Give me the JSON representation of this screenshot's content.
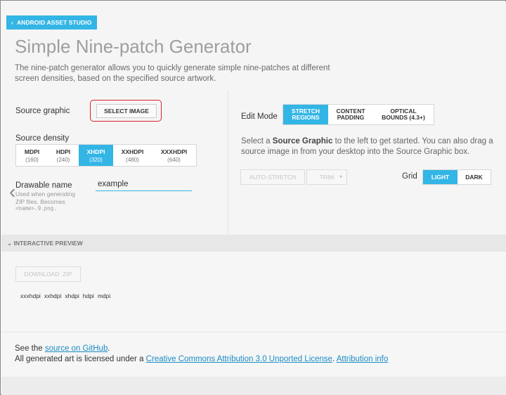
{
  "header": {
    "back_label": "ANDROID ASSET STUDIO",
    "title": "Simple Nine-patch Generator",
    "description": "The nine-patch generator allows you to quickly generate simple nine-patches at different screen densities, based on the specified source artwork."
  },
  "form": {
    "source_graphic_label": "Source graphic",
    "select_image_label": "SELECT IMAGE",
    "source_density_label": "Source density",
    "densities": [
      {
        "name": "MDPI",
        "value": "(160)"
      },
      {
        "name": "HDPI",
        "value": "(240)"
      },
      {
        "name": "XHDPI",
        "value": "(320)"
      },
      {
        "name": "XXHDPI",
        "value": "(480)"
      },
      {
        "name": "XXXHDPI",
        "value": "(640)"
      }
    ],
    "selected_density": "XHDPI",
    "drawable_name_label": "Drawable name",
    "drawable_name_value": "example",
    "help_line1": "Used when generating",
    "help_line2": "ZIP files. Becomes",
    "help_line3": "<name>.9.png."
  },
  "editor": {
    "edit_mode_label": "Edit Mode",
    "modes": [
      {
        "line1": "STRETCH",
        "line2": "REGIONS"
      },
      {
        "line1": "CONTENT",
        "line2": "PADDING"
      },
      {
        "line1": "OPTICAL",
        "line2": "BOUNDS (4.3+)"
      }
    ],
    "selected_mode": "STRETCH REGIONS",
    "hint_prefix": "Select a ",
    "hint_bold": "Source Graphic",
    "hint_suffix": " to the left to get started. You can also drag a source image in from your desktop into the Source Graphic box.",
    "auto_stretch_label": "AUTO-STRETCH",
    "trim_label": "TRIM",
    "grid_label": "Grid",
    "grid_options": [
      "LIGHT",
      "DARK"
    ],
    "selected_grid": "LIGHT"
  },
  "preview": {
    "section_title": "INTERACTIVE PREVIEW",
    "download_label": "DOWNLOAD .ZIP",
    "density_names": [
      "xxxhdpi",
      "xxhdpi",
      "xhdpi",
      "hdpi",
      "mdpi"
    ]
  },
  "footer": {
    "line1_prefix": "See the ",
    "line1_link": "source on GitHub",
    "line1_suffix": ".",
    "line2_prefix": "All generated art is licensed under a ",
    "line2_link1": "Creative Commons Attribution 3.0 Unported License",
    "line2_mid": ". ",
    "line2_link2": "Attribution info"
  },
  "colors": {
    "accent": "#33b5e5",
    "highlight_ring": "#d9232b",
    "link": "#1a8cc4"
  }
}
